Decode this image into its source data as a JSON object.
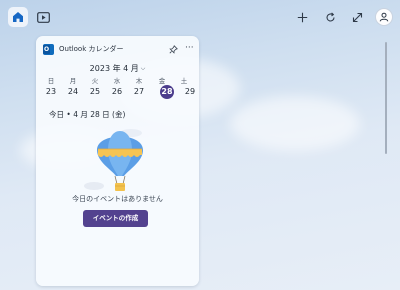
{
  "toolbar": {
    "home_icon": "home-icon",
    "video_icon": "play-video-icon",
    "add_icon": "plus-icon",
    "refresh_icon": "refresh-icon",
    "expand_icon": "expand-icon",
    "account_icon": "person-icon"
  },
  "widget": {
    "title": "Outlook カレンダー",
    "app_icon": "outlook-icon",
    "pin_icon": "pin-icon",
    "more_label": "···",
    "month_label": "2023 年 4 月",
    "month_chevron": "⌵",
    "weekdays": [
      "日",
      "月",
      "火",
      "水",
      "木",
      "金",
      "土"
    ],
    "dates": [
      "23",
      "24",
      "25",
      "26",
      "27",
      "28",
      "29"
    ],
    "selected_date": "28",
    "today_label": "今日 • 4 月 28 日 (金)",
    "illustration": "hot-air-balloon",
    "empty_message": "今日のイベントはありません",
    "create_button": "イベントの作成"
  },
  "colors": {
    "accent": "#53428f",
    "today_circle": "#4b3c8c",
    "outlook_blue": "#0f6cbd"
  }
}
